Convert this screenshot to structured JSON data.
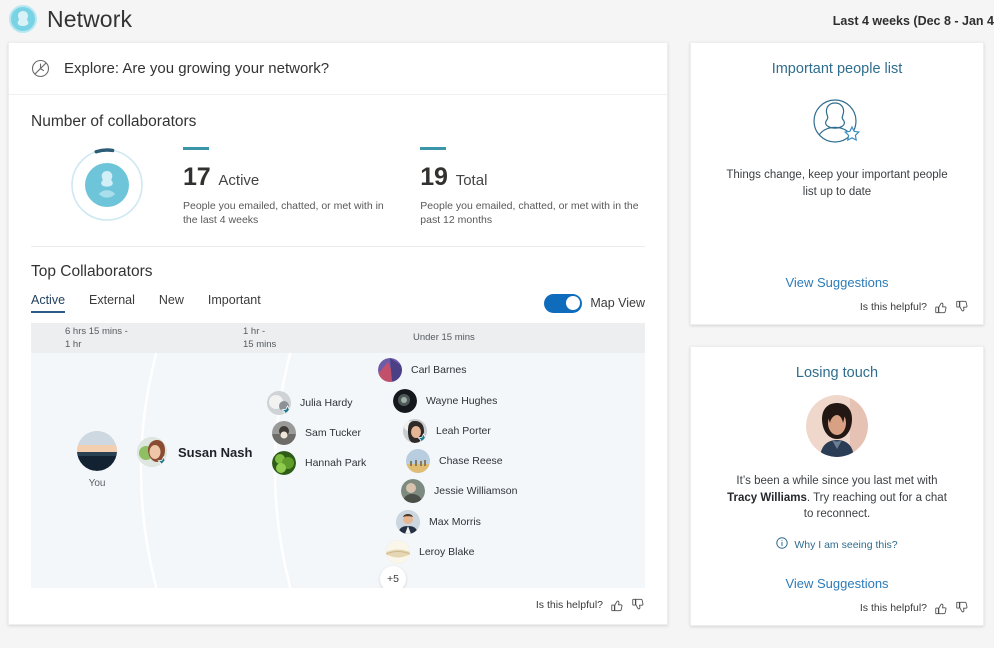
{
  "header": {
    "logo_icon": "network-logo-icon",
    "title": "Network",
    "date_range": "Last 4 weeks (Dec 8 - Jan 4"
  },
  "explore": {
    "icon": "clock-icon",
    "text": "Explore: Are you growing your network?"
  },
  "collaborators": {
    "section_title": "Number of collaborators",
    "stats": [
      {
        "value": "17",
        "label": "Active",
        "description": "People you emailed, chatted, or met with in the last 4 weeks"
      },
      {
        "value": "19",
        "label": "Total",
        "description": "People you emailed, chatted, or met with in the past 12 months"
      }
    ]
  },
  "top_collaborators": {
    "section_title": "Top Collaborators",
    "tabs": [
      {
        "label": "Active",
        "active": true
      },
      {
        "label": "External",
        "active": false
      },
      {
        "label": "New",
        "active": false
      },
      {
        "label": "Important",
        "active": false
      }
    ],
    "toggle": {
      "label": "Map View",
      "on": true
    },
    "bands": [
      "6 hrs 15 mins -\n1 hr",
      "1 hr -\n15 mins",
      "Under 15 mins"
    ],
    "band_labels": {
      "b0_line1": "6 hrs 15 mins -",
      "b0_line2": "1 hr",
      "b1_line1": "1 hr -",
      "b1_line2": "15 mins",
      "b2_line1": "Under 15 mins"
    },
    "you_label": "You",
    "more_badge": "+5",
    "people": [
      {
        "name": "Susan Nash",
        "important": true
      },
      {
        "name": "Julia Hardy",
        "important": true
      },
      {
        "name": "Sam Tucker",
        "important": false
      },
      {
        "name": "Hannah Park",
        "important": false
      },
      {
        "name": "Carl Barnes",
        "important": false
      },
      {
        "name": "Wayne Hughes",
        "important": false
      },
      {
        "name": "Leah Porter",
        "important": true
      },
      {
        "name": "Chase Reese",
        "important": false
      },
      {
        "name": "Jessie Williamson",
        "important": false
      },
      {
        "name": "Max Morris",
        "important": false
      },
      {
        "name": "Leroy Blake",
        "important": false
      }
    ],
    "helpful_text": "Is this helpful?"
  },
  "important_people_card": {
    "title": "Important people list",
    "art_icon": "person-star-icon",
    "body": "Things change, keep your important people list up to date",
    "action": "View Suggestions",
    "helpful_text": "Is this helpful?"
  },
  "losing_touch_card": {
    "title": "Losing touch",
    "avatar_icon": "person-photo-avatar",
    "body_before": "It’s been a while since you last met with ",
    "body_name": "Tracy Williams",
    "body_after": ". Try reaching out for a chat to reconnect.",
    "why_icon": "info-circle-icon",
    "why_link": "Why I am seeing this?",
    "action": "View Suggestions",
    "helpful_text": "Is this helpful?"
  },
  "icons": {
    "thumbs_up": "thumbs-up-icon",
    "thumbs_down": "thumbs-down-icon"
  },
  "colors": {
    "accent_teal": "#3a96a8",
    "link_blue": "#2c7bb8",
    "title_blue": "#2f6d8e",
    "toggle_on": "#0f6cbd",
    "map_bg": "#f4f7fa",
    "band_bg": "#eceef0",
    "star_badge": "#1b7a8c"
  }
}
